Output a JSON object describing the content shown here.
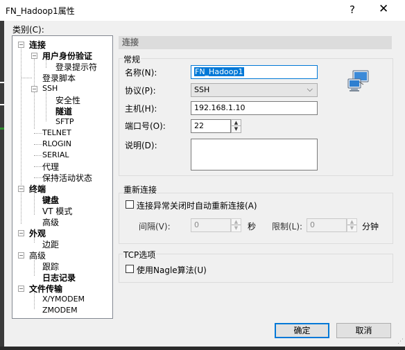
{
  "window": {
    "title": "FN_Hadoop1属性",
    "help": "?",
    "close": "✕"
  },
  "category": {
    "label": "类别(C):",
    "tree": {
      "connection": "连接",
      "auth": "用户身份验证",
      "login_prompt": "登录提示符",
      "login_script": "登录脚本",
      "ssh": "SSH",
      "security": "安全性",
      "tunnel": "隧道",
      "sftp": "SFTP",
      "telnet": "TELNET",
      "rlogin": "RLOGIN",
      "serial": "SERIAL",
      "proxy": "代理",
      "keepalive": "保持活动状态",
      "terminal": "终端",
      "keyboard": "键盘",
      "vt_mode": "VT 模式",
      "terminal_advanced": "高级",
      "appearance": "外观",
      "margin": "边距",
      "advanced": "高级",
      "trace": "跟踪",
      "logging": "日志记录",
      "file_transfer": "文件传输",
      "xymodem": "X/YMODEM",
      "zmodem": "ZMODEM"
    }
  },
  "panel": {
    "header": "连接",
    "general": {
      "title": "常规",
      "name_label": "名称(N):",
      "name_value": "FN_Hadoop1",
      "protocol_label": "协议(P):",
      "protocol_value": "SSH",
      "host_label": "主机(H):",
      "host_value": "192.168.1.10",
      "port_label": "端口号(O):",
      "port_value": "22",
      "desc_label": "说明(D):",
      "desc_value": ""
    },
    "reconnect": {
      "title": "重新连接",
      "auto_label": "连接异常关闭时自动重新连接(A)",
      "interval_label": "间隔(V):",
      "interval_value": "0",
      "interval_unit": "秒",
      "limit_label": "限制(L):",
      "limit_value": "0",
      "limit_unit": "分钟"
    },
    "tcp": {
      "title": "TCP选项",
      "nagle_label": "使用Nagle算法(U)"
    }
  },
  "buttons": {
    "ok": "确定",
    "cancel": "取消"
  }
}
